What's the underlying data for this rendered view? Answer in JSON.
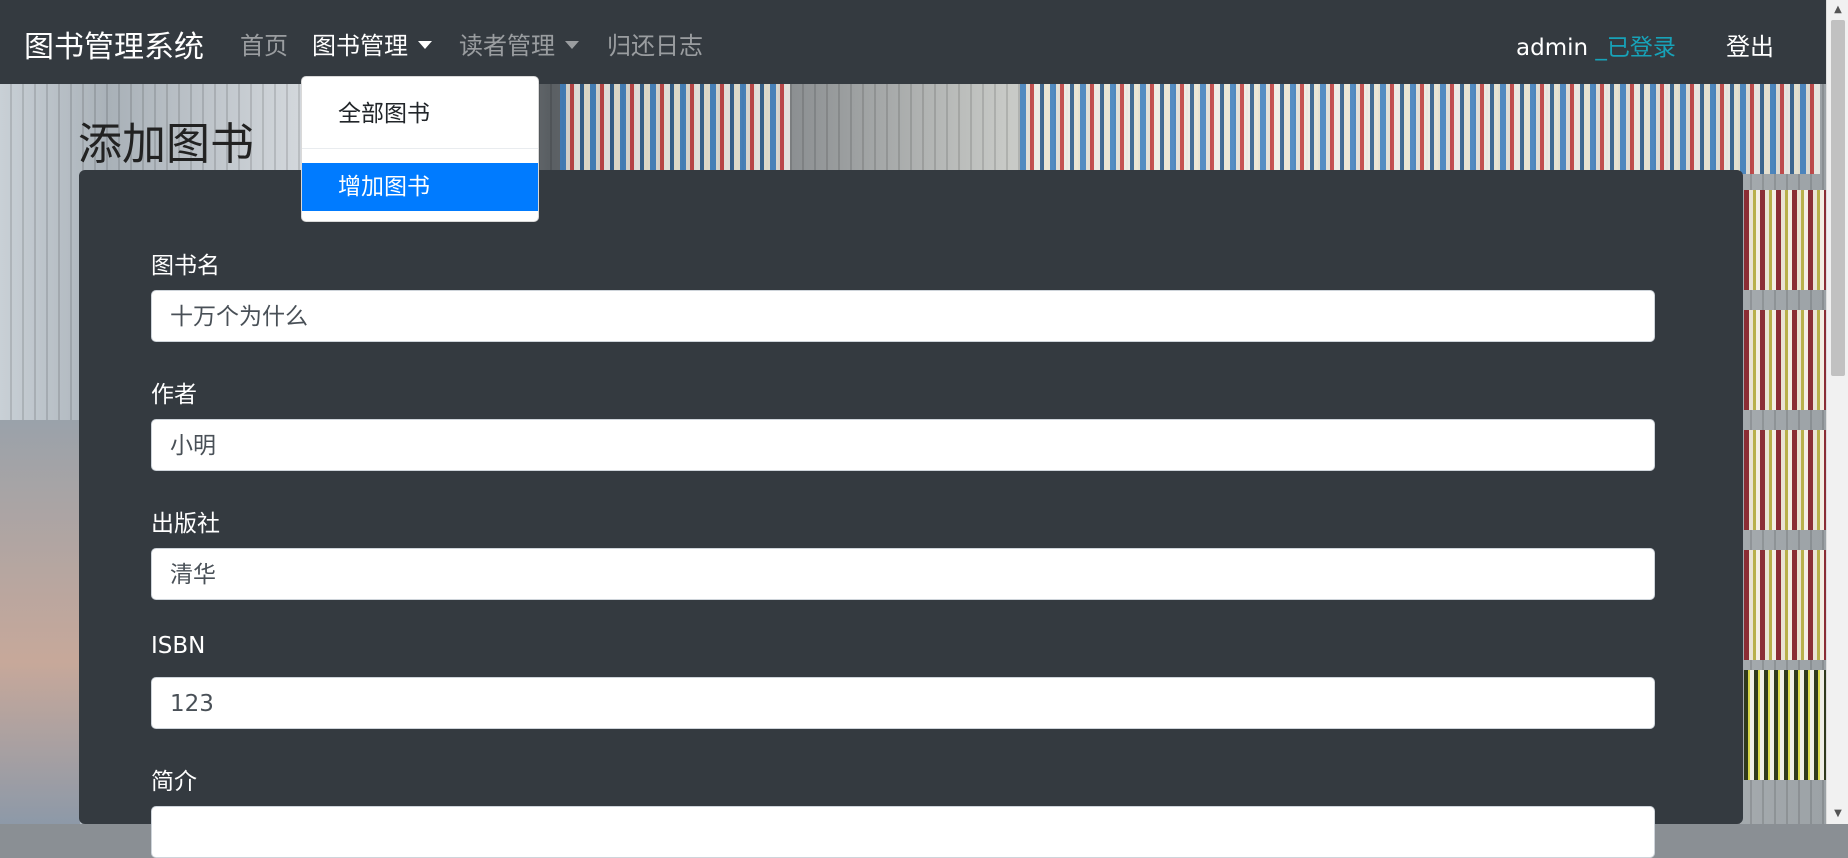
{
  "navbar": {
    "brand": "图书管理系统",
    "items": [
      {
        "label": "首页"
      },
      {
        "label": "图书管理"
      },
      {
        "label": "读者管理"
      },
      {
        "label": "归还日志"
      }
    ],
    "user": {
      "name": "admin",
      "status": "_已登录"
    },
    "logout": "登出"
  },
  "dropdown": {
    "items": [
      {
        "label": "全部图书"
      },
      {
        "label": "增加图书",
        "active": true
      }
    ]
  },
  "page": {
    "title": "添加图书"
  },
  "form": {
    "fields": [
      {
        "label": "图书名",
        "value": "十万个为什么"
      },
      {
        "label": "作者",
        "value": "小明"
      },
      {
        "label": "出版社",
        "value": "清华"
      },
      {
        "label": "ISBN",
        "value": "123"
      },
      {
        "label": "简介",
        "value": ""
      }
    ]
  },
  "colors": {
    "navbar": "#343a40",
    "accent": "#007bff",
    "status": "#17a2b8"
  }
}
